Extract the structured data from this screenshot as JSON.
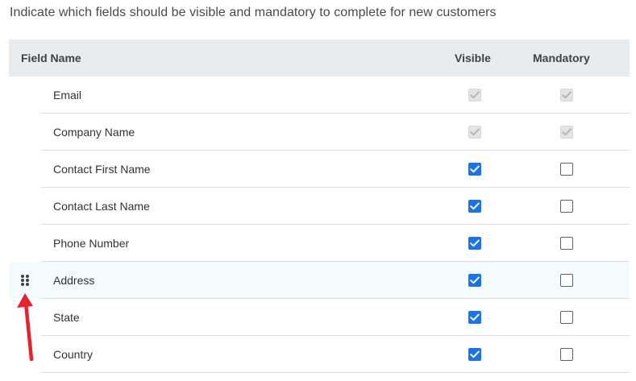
{
  "intro": "Indicate which fields should be visible and mandatory to complete for new customers",
  "columns": {
    "field_name": "Field Name",
    "visible": "Visible",
    "mandatory": "Mandatory"
  },
  "rows": [
    {
      "label": "Email",
      "visible": "checked-disabled",
      "mandatory": "checked-disabled"
    },
    {
      "label": "Company Name",
      "visible": "checked-disabled",
      "mandatory": "checked-disabled"
    },
    {
      "label": "Contact First Name",
      "visible": "checked",
      "mandatory": "unchecked"
    },
    {
      "label": "Contact Last Name",
      "visible": "checked",
      "mandatory": "unchecked"
    },
    {
      "label": "Phone Number",
      "visible": "checked",
      "mandatory": "unchecked"
    },
    {
      "label": "Address",
      "visible": "checked",
      "mandatory": "unchecked",
      "hovered": true
    },
    {
      "label": "State",
      "visible": "checked",
      "mandatory": "unchecked"
    },
    {
      "label": "Country",
      "visible": "checked",
      "mandatory": "unchecked"
    }
  ],
  "icons": {
    "drag_handle": "drag-handle-icon",
    "annotation_arrow": "red-arrow-icon"
  },
  "colors": {
    "checkbox_checked": "#1a73e8",
    "checkbox_disabled": "#e3e4e6",
    "header_bg": "#e9ecef",
    "hover_row_bg": "#f4fbfc",
    "arrow": "#e8212e"
  }
}
